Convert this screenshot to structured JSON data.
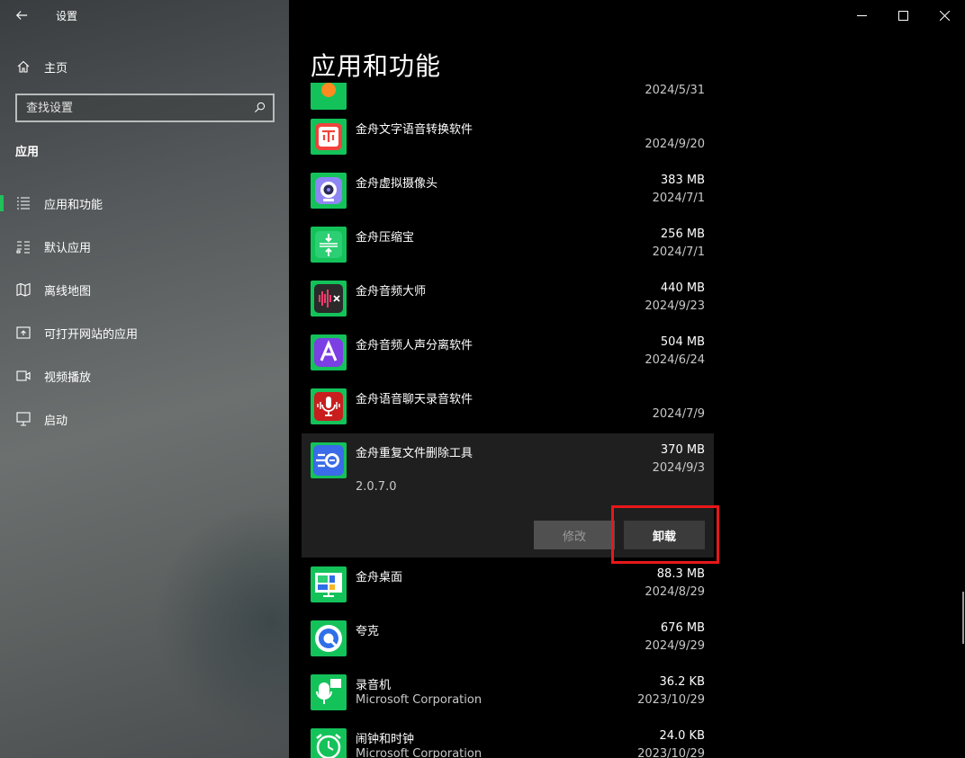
{
  "window": {
    "title": "设置",
    "controls": {
      "minimize": "minimize-icon",
      "maximize": "maximize-icon",
      "close": "close-icon"
    }
  },
  "sidebar": {
    "home_label": "主页",
    "search_placeholder": "查找设置",
    "section_title": "应用",
    "items": [
      {
        "label": "应用和功能",
        "icon": "apps-features-icon",
        "active": true
      },
      {
        "label": "默认应用",
        "icon": "default-apps-icon",
        "active": false
      },
      {
        "label": "离线地图",
        "icon": "offline-maps-icon",
        "active": false
      },
      {
        "label": "可打开网站的应用",
        "icon": "apps-for-websites-icon",
        "active": false
      },
      {
        "label": "视频播放",
        "icon": "video-playback-icon",
        "active": false
      },
      {
        "label": "启动",
        "icon": "startup-icon",
        "active": false
      }
    ]
  },
  "main": {
    "title": "应用和功能",
    "apps": [
      {
        "name": "",
        "publisher": "",
        "size": "",
        "date": "2024/5/31",
        "icon": "orange-app-icon"
      },
      {
        "name": "金舟文字语音转换软件",
        "publisher": "",
        "size": "",
        "date": "2024/9/20",
        "icon": "text-to-speech-icon"
      },
      {
        "name": "金舟虚拟摄像头",
        "publisher": "",
        "size": "383 MB",
        "date": "2024/7/1",
        "icon": "webcam-icon"
      },
      {
        "name": "金舟压缩宝",
        "publisher": "",
        "size": "256 MB",
        "date": "2024/7/1",
        "icon": "compress-icon"
      },
      {
        "name": "金舟音频大师",
        "publisher": "",
        "size": "440 MB",
        "date": "2024/9/23",
        "icon": "audio-editor-icon"
      },
      {
        "name": "金舟音频人声分离软件",
        "publisher": "",
        "size": "504 MB",
        "date": "2024/6/24",
        "icon": "vocal-separator-icon"
      },
      {
        "name": "金舟语音聊天录音软件",
        "publisher": "",
        "size": "",
        "date": "2024/7/9",
        "icon": "voice-recorder-icon"
      },
      {
        "name": "金舟重复文件删除工具",
        "publisher": "",
        "size": "370 MB",
        "date": "2024/9/3",
        "icon": "duplicate-file-icon",
        "expanded": true,
        "version": "2.0.7.0",
        "modify_label": "修改",
        "uninstall_label": "卸载"
      },
      {
        "name": "金舟桌面",
        "publisher": "",
        "size": "88.3 MB",
        "date": "2024/8/29",
        "icon": "desktop-icon"
      },
      {
        "name": "夸克",
        "publisher": "",
        "size": "676 MB",
        "date": "2024/9/29",
        "icon": "quark-icon"
      },
      {
        "name": "录音机",
        "publisher": "Microsoft Corporation",
        "size": "36.2 KB",
        "date": "2023/10/29",
        "icon": "sound-recorder-icon"
      },
      {
        "name": "闹钟和时钟",
        "publisher": "Microsoft Corporation",
        "size": "24.0 KB",
        "date": "2023/10/29",
        "icon": "alarms-clock-icon"
      }
    ]
  },
  "colors": {
    "accent": "#21c05a",
    "highlight": "#e8171a",
    "app_tile": "#14c25a"
  }
}
